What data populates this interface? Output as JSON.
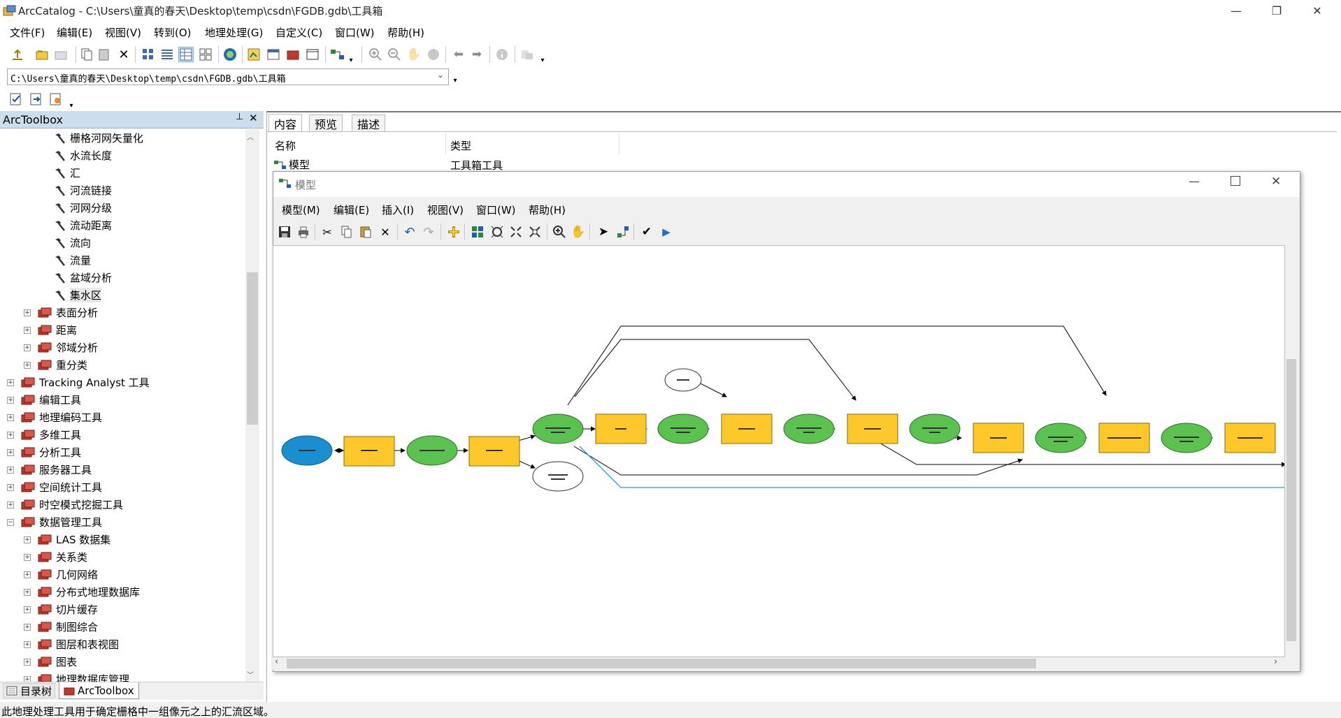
{
  "titlebar": {
    "title": "ArcCatalog - C:\\Users\\童真的春天\\Desktop\\temp\\csdn\\FGDB.gdb\\工具箱",
    "minimize": "—",
    "restore": "❐",
    "close": "✕"
  },
  "menu": [
    "文件(F)",
    "编辑(E)",
    "视图(V)",
    "转到(O)",
    "地理处理(G)",
    "自定义(C)",
    "窗口(W)",
    "帮助(H)"
  ],
  "address": {
    "value": "C:\\Users\\童真的春天\\Desktop\\temp\\csdn\\FGDB.gdb\\工具箱"
  },
  "left_panel": {
    "title": "ArcToolbox",
    "pin": "📌",
    "close": "✕",
    "tools": [
      "栅格河网矢量化",
      "水流长度",
      "汇",
      "河流链接",
      "河网分级",
      "流动距离",
      "流向",
      "流量",
      "盆域分析",
      "集水区"
    ],
    "toolsets_a": [
      "表面分析",
      "距离",
      "邻域分析",
      "重分类"
    ],
    "toolboxes": [
      "Tracking Analyst 工具",
      "编辑工具",
      "地理编码工具",
      "多维工具",
      "分析工具",
      "服务器工具",
      "空间统计工具",
      "时空模式挖掘工具",
      "数据管理工具"
    ],
    "toolsets_b": [
      "LAS 数据集",
      "关系类",
      "几何网络",
      "分布式地理数据库",
      "切片缓存",
      "制图综合",
      "图层和表视图",
      "图表",
      "地理数据库管理"
    ],
    "tab_catalog": "目录树",
    "tab_arctoolbox": "ArcToolbox"
  },
  "right_panel": {
    "tabs": [
      "内容",
      "预览",
      "描述"
    ],
    "col_name": "名称",
    "col_type": "类型",
    "row_name": "模型",
    "row_type": "工具箱工具"
  },
  "model_window": {
    "title": "模型",
    "menu": [
      "模型(M)",
      "编辑(E)",
      "插入(I)",
      "视图(V)",
      "窗口(W)",
      "帮助(H)"
    ]
  },
  "status": "此地理处理工具用于确定栅格中一组像元之上的汇流区域。",
  "colors": {
    "panel_header": "#ccddee",
    "tool_yellow": "#ffc82a",
    "data_green": "#5bc24f",
    "input_blue": "#1b8ed0",
    "connector_blue": "#2a9fd6"
  }
}
